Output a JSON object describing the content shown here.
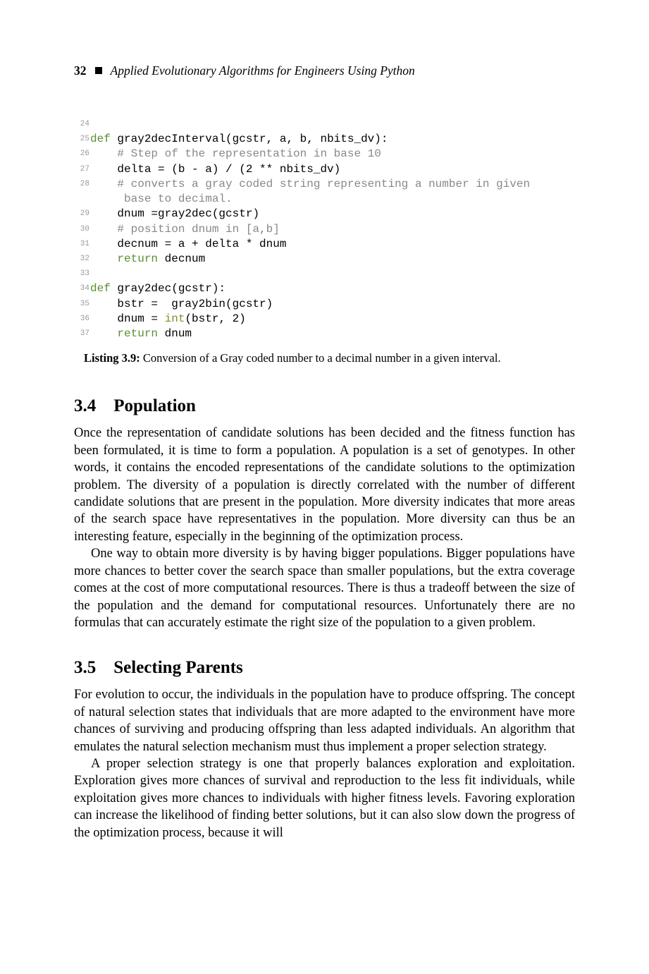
{
  "header": {
    "page_number": "32",
    "book_title": "Applied Evolutionary Algorithms for Engineers Using Python"
  },
  "code": {
    "lines": [
      {
        "n": "24",
        "t": ""
      },
      {
        "n": "25",
        "t": "def gray2decInterval(gcstr, a, b, nbits_dv):",
        "kw": "def "
      },
      {
        "n": "26",
        "t": "    # Step of the representation in base 10",
        "com": true
      },
      {
        "n": "27",
        "t": "    delta = (b - a) / (2 ** nbits_dv)"
      },
      {
        "n": "28",
        "t": "    # converts a gray coded string representing a number in given\n     base to decimal.",
        "com": true
      },
      {
        "n": "29",
        "t": "    dnum =gray2dec(gcstr)"
      },
      {
        "n": "30",
        "t": "    # position dnum in [a,b]",
        "com": true
      },
      {
        "n": "31",
        "t": "    decnum = a + delta * dnum"
      },
      {
        "n": "32",
        "t": "    return decnum",
        "kw": "return "
      },
      {
        "n": "33",
        "t": ""
      },
      {
        "n": "34",
        "t": "def gray2dec(gcstr):",
        "kw": "def "
      },
      {
        "n": "35",
        "t": "    bstr =  gray2bin(gcstr)"
      },
      {
        "n": "36",
        "t": "    dnum = int(bstr, 2)",
        "builtin": "int"
      },
      {
        "n": "37",
        "t": "    return dnum",
        "kw": "return "
      }
    ]
  },
  "listing": {
    "label": "Listing 3.9:",
    "caption": " Conversion of a Gray coded number to a decimal number in a given interval."
  },
  "sections": [
    {
      "number": "3.4",
      "title": "Population",
      "paragraphs": [
        "Once the representation of candidate solutions has been decided and the fitness function has been formulated, it is time to form a population. A population is a set of genotypes. In other words, it contains the encoded representations of the candidate solutions to the optimization problem. The diversity of a population is directly correlated with the number of different candidate solutions that are present in the population. More diversity indicates that more areas of the search space have representatives in the population. More diversity can thus be an interesting feature, especially in the beginning of the optimization process.",
        "One way to obtain more diversity is by having bigger populations. Bigger populations have more chances to better cover the search space than smaller populations, but the extra coverage comes at the cost of more computational resources. There is thus a tradeoff between the size of the population and the demand for computational resources. Unfortunately there are no formulas that can accurately estimate the right size of the population to a given problem."
      ]
    },
    {
      "number": "3.5",
      "title": "Selecting Parents",
      "paragraphs": [
        "For evolution to occur, the individuals in the population have to produce offspring. The concept of natural selection states that individuals that are more adapted to the environment have more chances of surviving and producing offspring than less adapted individuals. An algorithm that emulates the natural selection mechanism must thus implement a proper selection strategy.",
        "A proper selection strategy is one that properly balances exploration and exploitation. Exploration gives more chances of survival and reproduction to the less fit individuals, while exploitation gives more chances to individuals with higher fitness levels. Favoring exploration can increase the likelihood of finding better solutions, but it can also slow down the progress of the optimization process, because it will"
      ]
    }
  ]
}
